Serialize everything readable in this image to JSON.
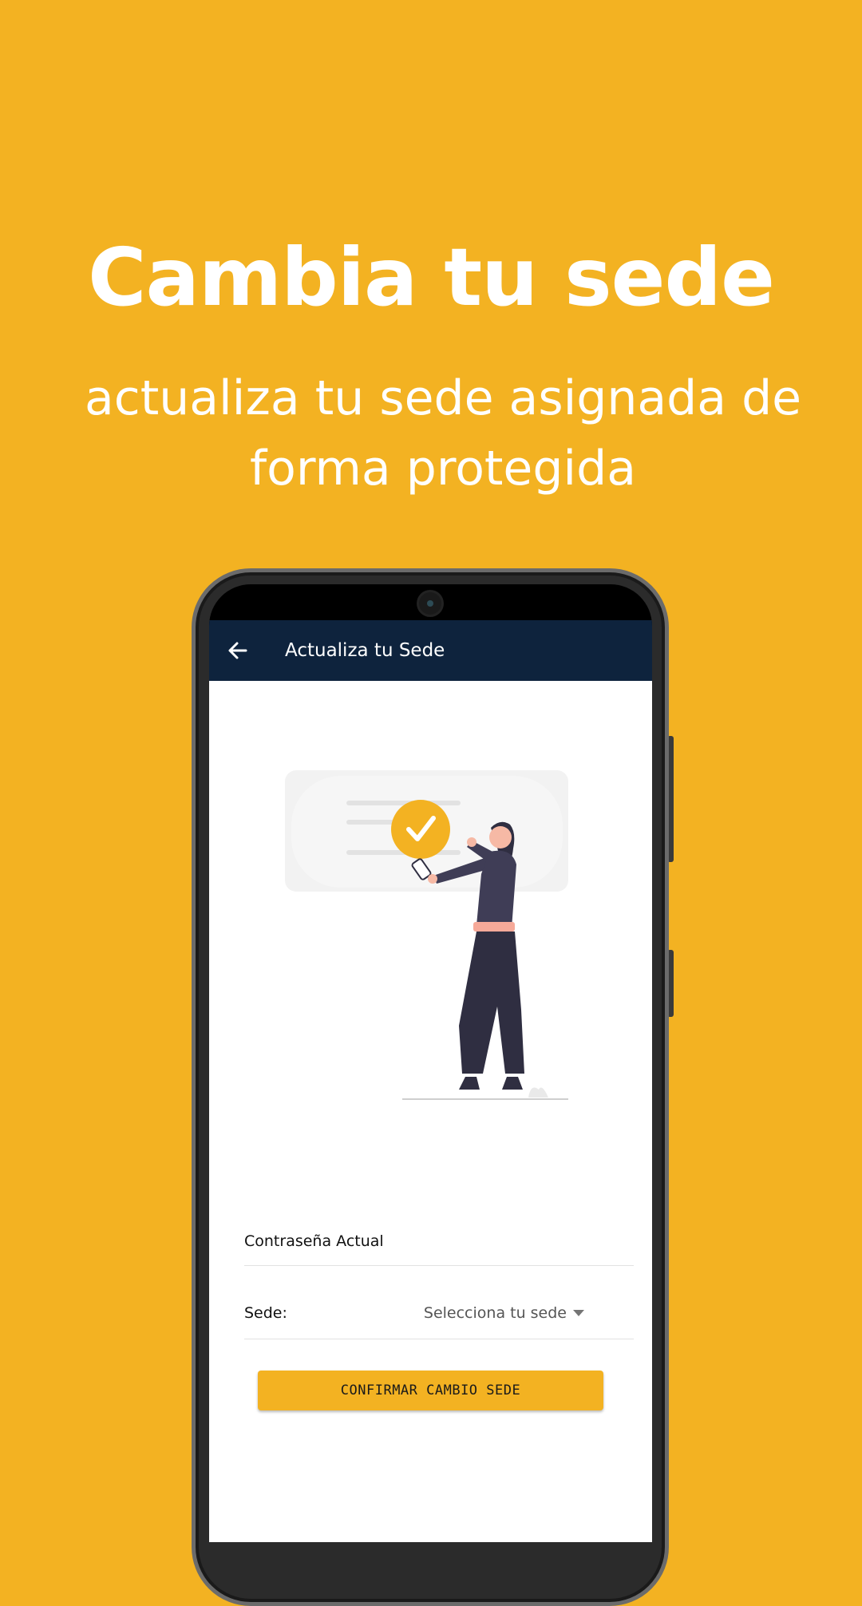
{
  "promo": {
    "headline": "Cambia tu sede",
    "subheadline": "actualiza tu sede asignada de forma protegida"
  },
  "colors": {
    "background": "#F3B222",
    "appbar": "#0E233D",
    "accent": "#F3B222"
  },
  "appbar": {
    "title": "Actualiza tu Sede",
    "back_icon": "arrow-left-icon"
  },
  "form": {
    "password_label": "Contraseña Actual",
    "sede_label": "Sede:",
    "sede_value": "Selecciona tu sede",
    "confirm_label": "CONFIRMAR CAMBIO SEDE"
  }
}
